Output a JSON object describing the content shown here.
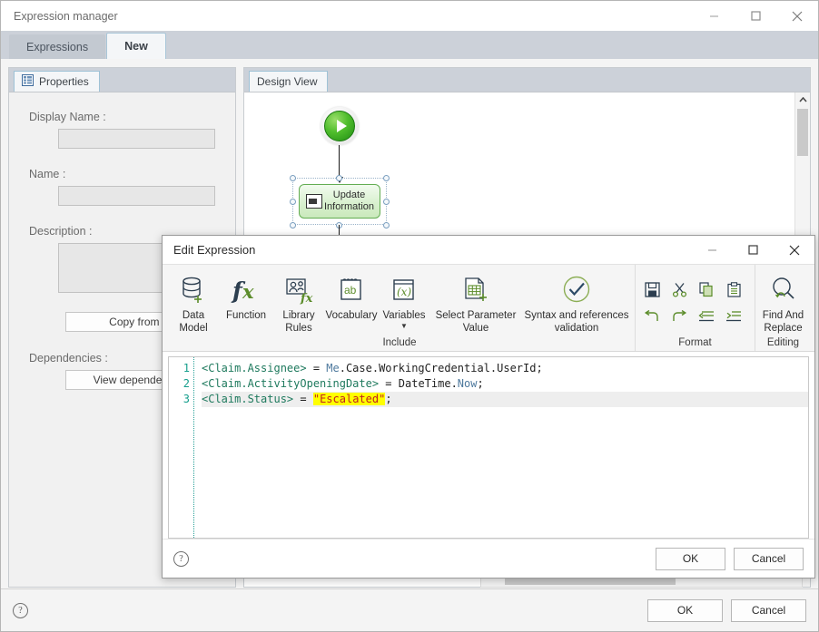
{
  "main_window": {
    "title": "Expression manager",
    "controls": {
      "minimize": "minimize-icon",
      "maximize": "maximize-icon",
      "close": "close-icon"
    },
    "tabs": [
      {
        "label": "Expressions",
        "active": false
      },
      {
        "label": "New",
        "active": true
      }
    ],
    "footer": {
      "help": "?",
      "ok_label": "OK",
      "cancel_label": "Cancel"
    }
  },
  "properties_panel": {
    "tab_label": "Properties",
    "tab_icon": "properties-icon",
    "fields": [
      {
        "label": "Display Name :",
        "value": ""
      },
      {
        "label": "Name :",
        "value": ""
      },
      {
        "label": "Description :",
        "value": ""
      }
    ],
    "copy_from_label": "Copy from ...",
    "dependencies_label": "Dependencies :",
    "view_dependencies_label": "View dependencies"
  },
  "design_panel": {
    "tab_label": "Design View",
    "nodes": [
      {
        "type": "start",
        "name": "start-node"
      },
      {
        "type": "activity",
        "label": "Update Information",
        "selected": true
      }
    ]
  },
  "edit_expression_dialog": {
    "title": "Edit Expression",
    "controls": {
      "minimize": "minimize-icon",
      "maximize": "maximize-icon",
      "close": "close-icon"
    },
    "ribbon": {
      "groups": [
        {
          "name": "include",
          "group_label": "Include",
          "items": [
            {
              "label": "Data Model",
              "icon": "data-model-icon"
            },
            {
              "label": "Function",
              "icon": "function-fx-icon"
            },
            {
              "label": "Library Rules",
              "icon": "library-rules-icon"
            },
            {
              "label": "Vocabulary",
              "icon": "vocabulary-icon"
            },
            {
              "label": "Variables",
              "icon": "variables-icon",
              "has_caret": true
            },
            {
              "label": "Select Parameter Value",
              "icon": "select-parameter-value-icon"
            },
            {
              "label": "Syntax and references validation",
              "icon": "validation-check-icon"
            }
          ]
        },
        {
          "name": "format",
          "group_label": "Format",
          "items": [
            {
              "label": "Save",
              "icon": "save-icon"
            },
            {
              "label": "Cut",
              "icon": "cut-icon"
            },
            {
              "label": "Copy",
              "icon": "copy-icon"
            },
            {
              "label": "Paste",
              "icon": "paste-icon"
            },
            {
              "label": "Undo",
              "icon": "undo-icon"
            },
            {
              "label": "Redo",
              "icon": "redo-icon"
            },
            {
              "label": "Decrease Indent",
              "icon": "outdent-icon"
            },
            {
              "label": "Increase Indent",
              "icon": "indent-icon"
            }
          ]
        },
        {
          "name": "editing",
          "group_label": "Editing",
          "items": [
            {
              "label": "Find And Replace",
              "icon": "find-replace-icon"
            }
          ]
        }
      ]
    },
    "editor": {
      "line_numbers": [
        "1",
        "2",
        "3"
      ],
      "current_line": 3,
      "lines": [
        {
          "number": "1",
          "tokens": [
            {
              "t": "<Claim.Assignee>",
              "c": "tok-tag"
            },
            {
              "t": " = ",
              "c": "tok-op"
            },
            {
              "t": "Me",
              "c": "tok-ns"
            },
            {
              "t": ".Case.WorkingCredential.",
              "c": "tok-plain"
            },
            {
              "t": "UserId",
              "c": "tok-plain"
            },
            {
              "t": ";",
              "c": "tok-op"
            }
          ]
        },
        {
          "number": "2",
          "tokens": [
            {
              "t": "<Claim.ActivityOpeningDate>",
              "c": "tok-tag"
            },
            {
              "t": " = ",
              "c": "tok-op"
            },
            {
              "t": "DateTime",
              "c": "tok-plain"
            },
            {
              "t": ".",
              "c": "tok-plain"
            },
            {
              "t": "Now",
              "c": "tok-ns"
            },
            {
              "t": ";",
              "c": "tok-op"
            }
          ]
        },
        {
          "number": "3",
          "tokens": [
            {
              "t": "<Claim.Status>",
              "c": "tok-tag"
            },
            {
              "t": " = ",
              "c": "tok-op"
            },
            {
              "t": "\"Escalated\"",
              "c": "tok-str"
            },
            {
              "t": ";",
              "c": "tok-op"
            }
          ]
        }
      ],
      "plain_text": "<Claim.Assignee> = Me.Case.WorkingCredential.UserId;\n<Claim.ActivityOpeningDate> = DateTime.Now;\n<Claim.Status> = \"Escalated\";"
    },
    "footer": {
      "help": "?",
      "ok_label": "OK",
      "cancel_label": "Cancel"
    }
  },
  "colors": {
    "tabstrip": "#ccd1d9",
    "accent_green": "#1f7a5e",
    "ribbon_icon_green": "#5b8c2a",
    "ribbon_icon_dark": "#2c3e4f",
    "highlight_yellow": "#ffff00",
    "string_red": "#c02020",
    "node_green": "#63ad52"
  }
}
